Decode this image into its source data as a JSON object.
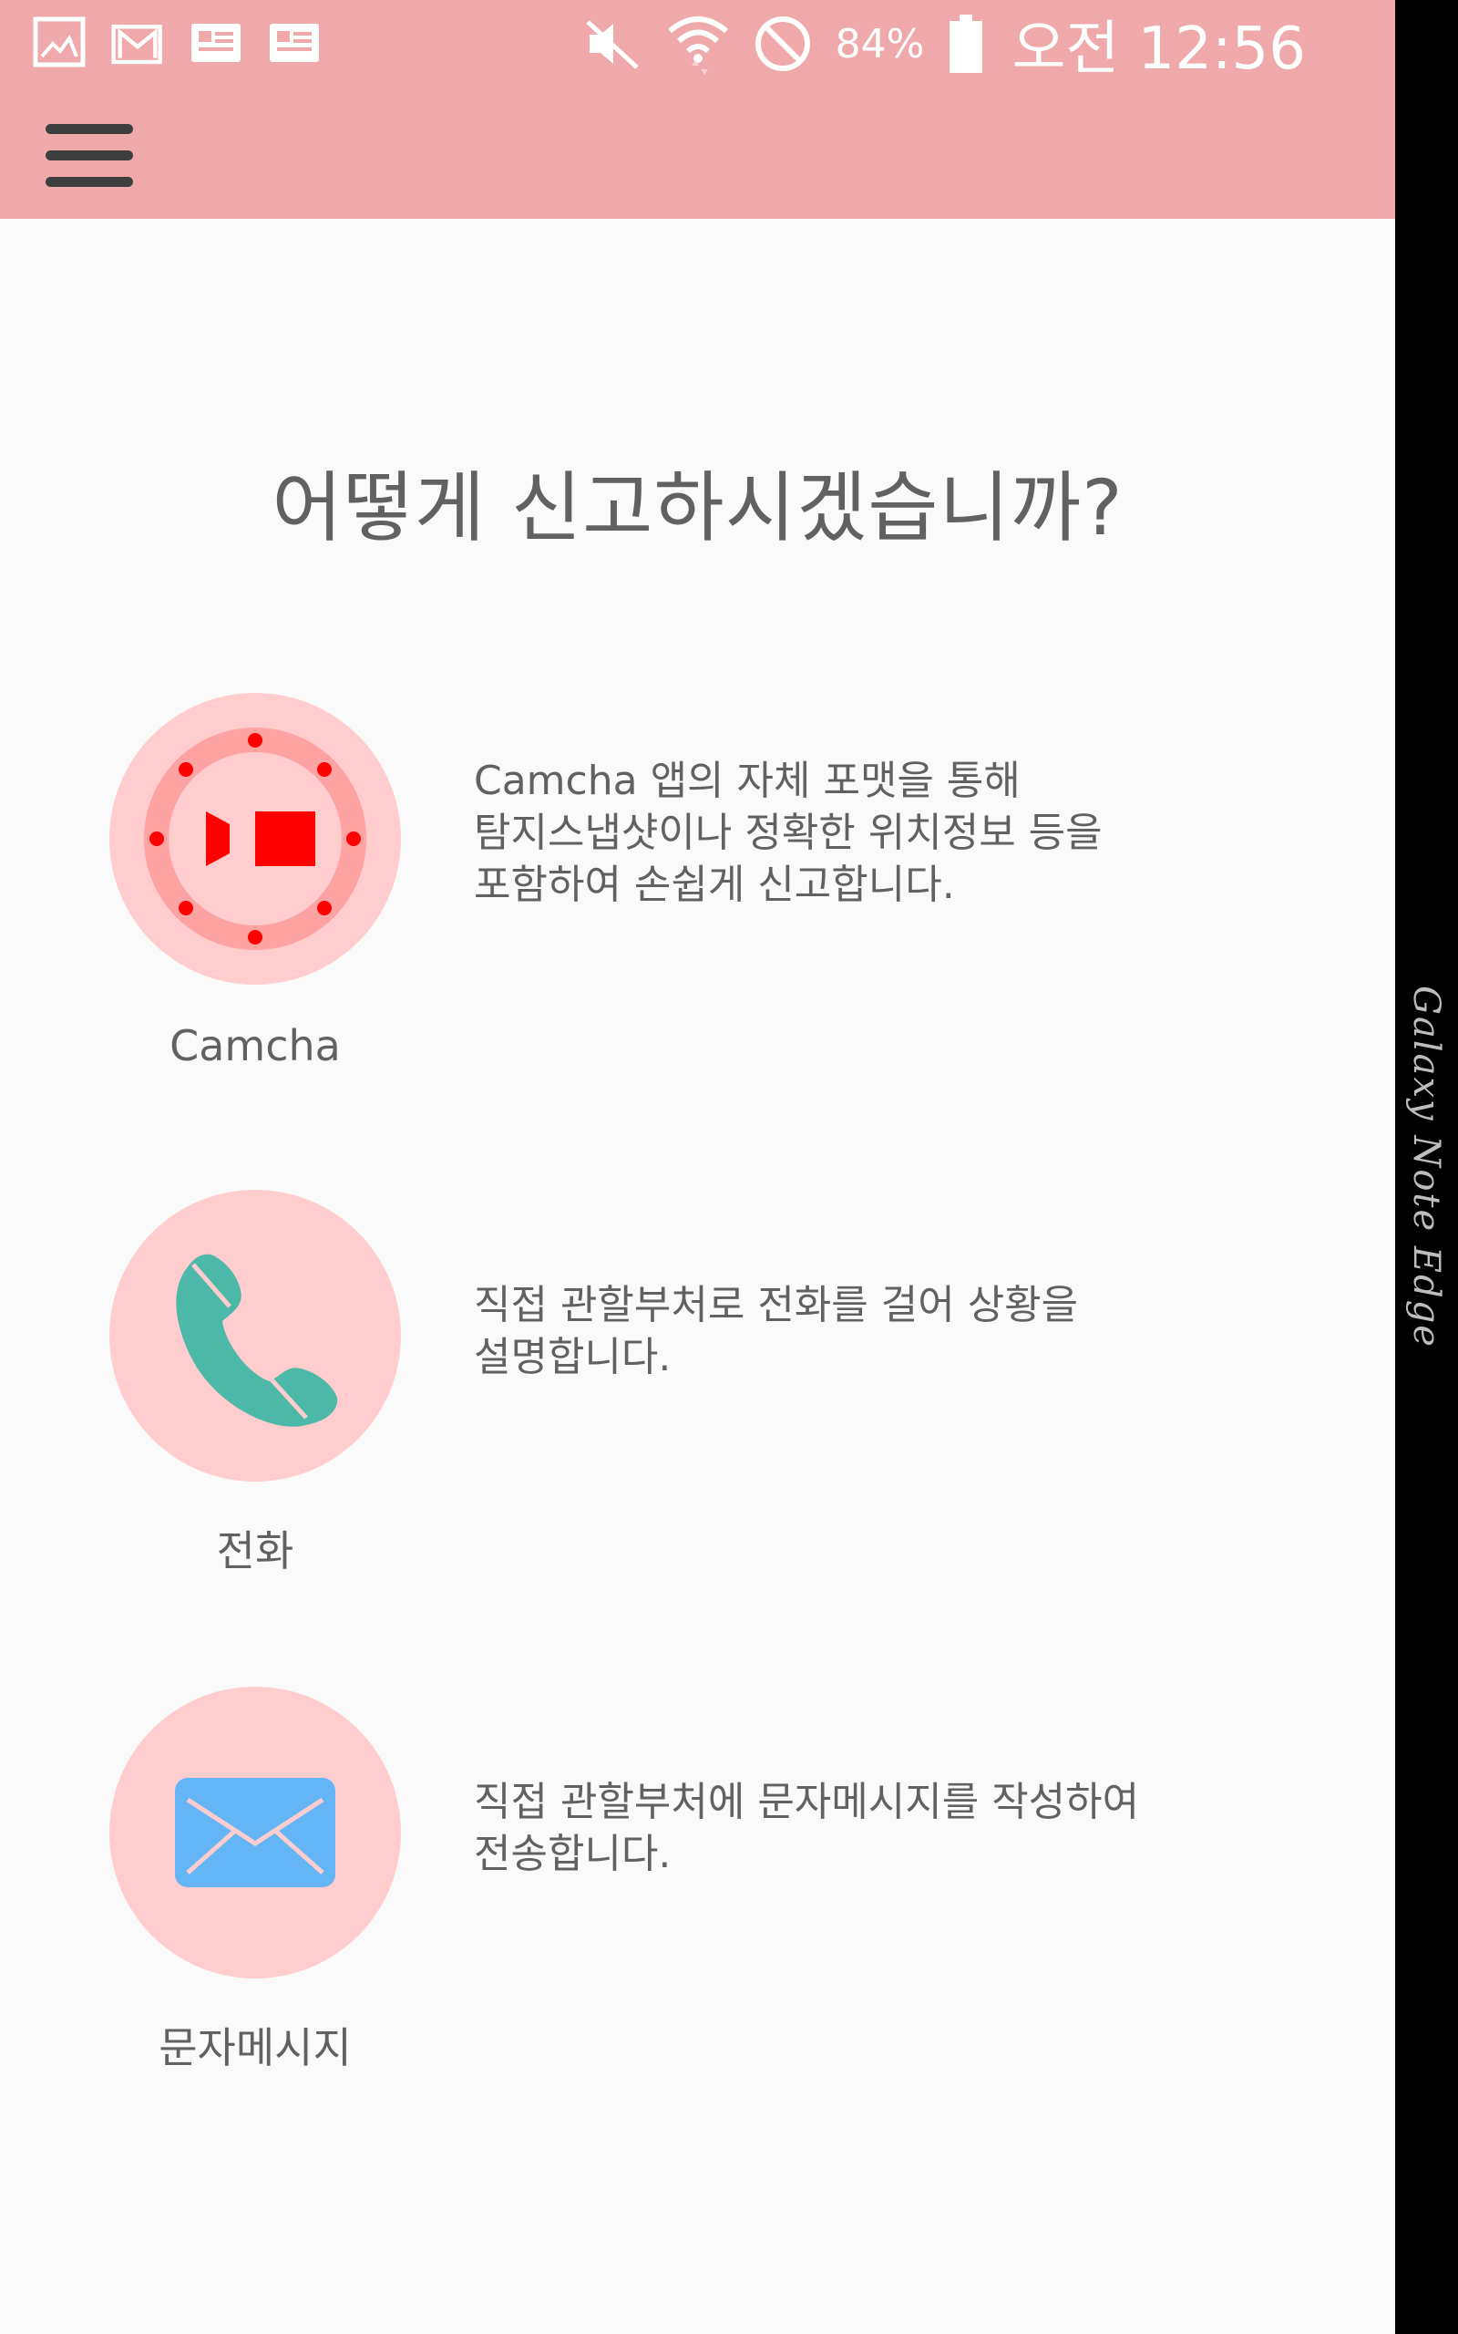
{
  "status_bar": {
    "battery_percent": "84%",
    "time": "오전 12:56",
    "left_icons": [
      "gallery-icon",
      "gmail-icon",
      "news-icon",
      "news-icon"
    ],
    "right_icons": [
      "mute-icon",
      "wifi-icon",
      "do-not-disturb-icon",
      "battery-icon"
    ]
  },
  "app_bar": {
    "menu_icon": "hamburger-menu-icon",
    "color": "#efa9aa"
  },
  "edge_panel": {
    "text": "Galaxy Note Edge"
  },
  "main": {
    "heading": "어떻게 신고하시겠습니까?",
    "options": [
      {
        "id": "camcha",
        "icon": "camcha-video-icon",
        "label": "Camcha",
        "description": "Camcha 앱의 자체 포맷을 통해\n탐지스냅샷이나 정확한 위치정보 등을\n포함하여 손쉽게 신고합니다."
      },
      {
        "id": "call",
        "icon": "phone-icon",
        "label": "전화",
        "description": "직접 관할부처로 전화를 걸어 상황을\n설명합니다."
      },
      {
        "id": "sms",
        "icon": "envelope-icon",
        "label": "문자메시지",
        "description": "직접 관할부처에 문자메시지를 작성하여\n전송합니다."
      }
    ]
  },
  "colors": {
    "circle_bg": "#ffcdcd",
    "accent_red": "#ff0000",
    "phone_teal": "#4cb8a8",
    "envelope_blue": "#64b5f6"
  }
}
